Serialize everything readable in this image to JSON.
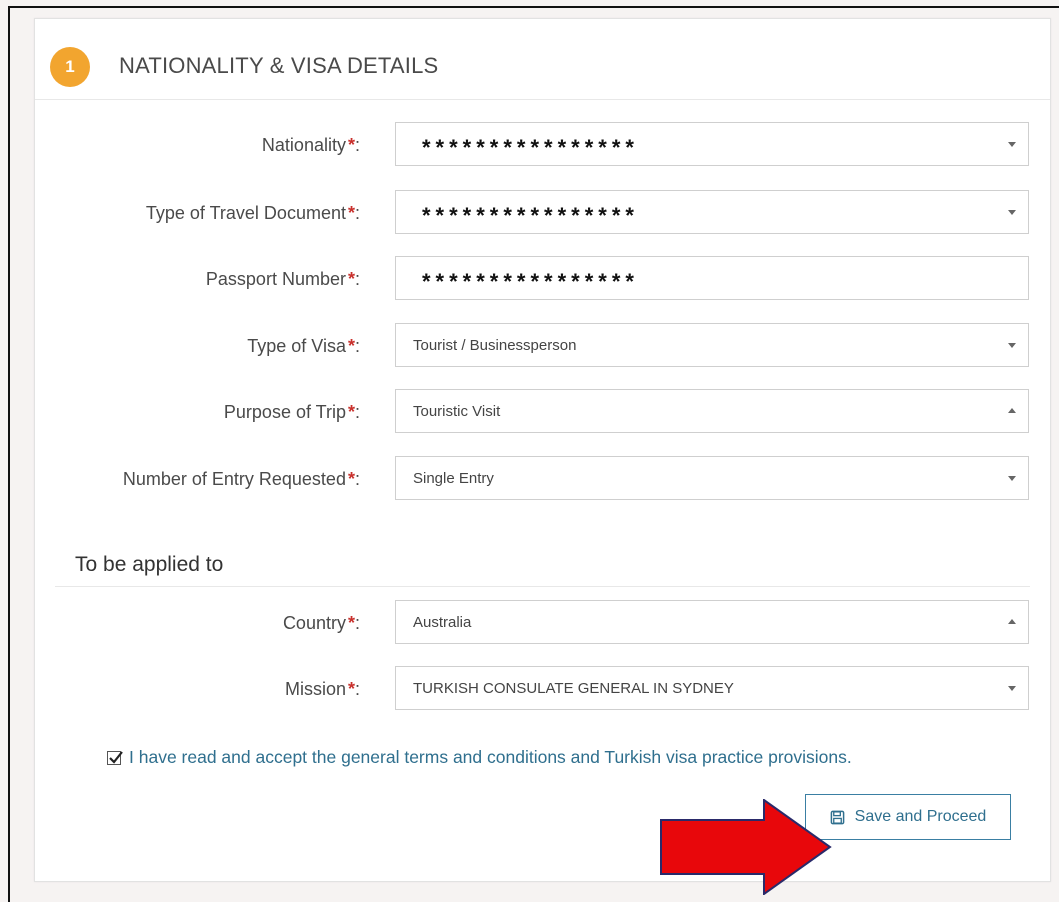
{
  "section": {
    "step_number": "1",
    "title": "NATIONALITY & VISA DETAILS"
  },
  "required_marker": "*",
  "colon": ":",
  "fields": [
    {
      "label": "Nationality",
      "value": "****************",
      "masked": true,
      "control": "select",
      "caret": "down"
    },
    {
      "label": "Type of Travel Document",
      "value": "****************",
      "masked": true,
      "control": "select",
      "caret": "down"
    },
    {
      "label": "Passport Number",
      "value": "****************",
      "masked": true,
      "control": "input"
    },
    {
      "label": "Type of Visa",
      "value": "Tourist / Businessperson",
      "masked": false,
      "control": "select",
      "caret": "down"
    },
    {
      "label": "Purpose of Trip",
      "value": "Touristic Visit",
      "masked": false,
      "control": "select",
      "caret": "up"
    },
    {
      "label": "Number of Entry Requested",
      "value": "Single Entry",
      "masked": false,
      "control": "select",
      "caret": "down"
    }
  ],
  "applied_to": {
    "title": "To be applied to",
    "fields": [
      {
        "label": "Country",
        "value": "Australia",
        "control": "select",
        "caret": "up"
      },
      {
        "label": "Mission",
        "value": "TURKISH CONSULATE GENERAL IN SYDNEY",
        "control": "select",
        "caret": "down"
      }
    ]
  },
  "terms": {
    "checked": true,
    "text": "I have read and accept the general terms and conditions and Turkish visa practice provisions."
  },
  "actions": {
    "save_label": "Save and Proceed",
    "save_icon": "floppy-disk-icon"
  },
  "colors": {
    "accent": "#f2a52f",
    "link": "#2f6f8e",
    "required": "#c9302c",
    "arrow": "#e8070b"
  }
}
